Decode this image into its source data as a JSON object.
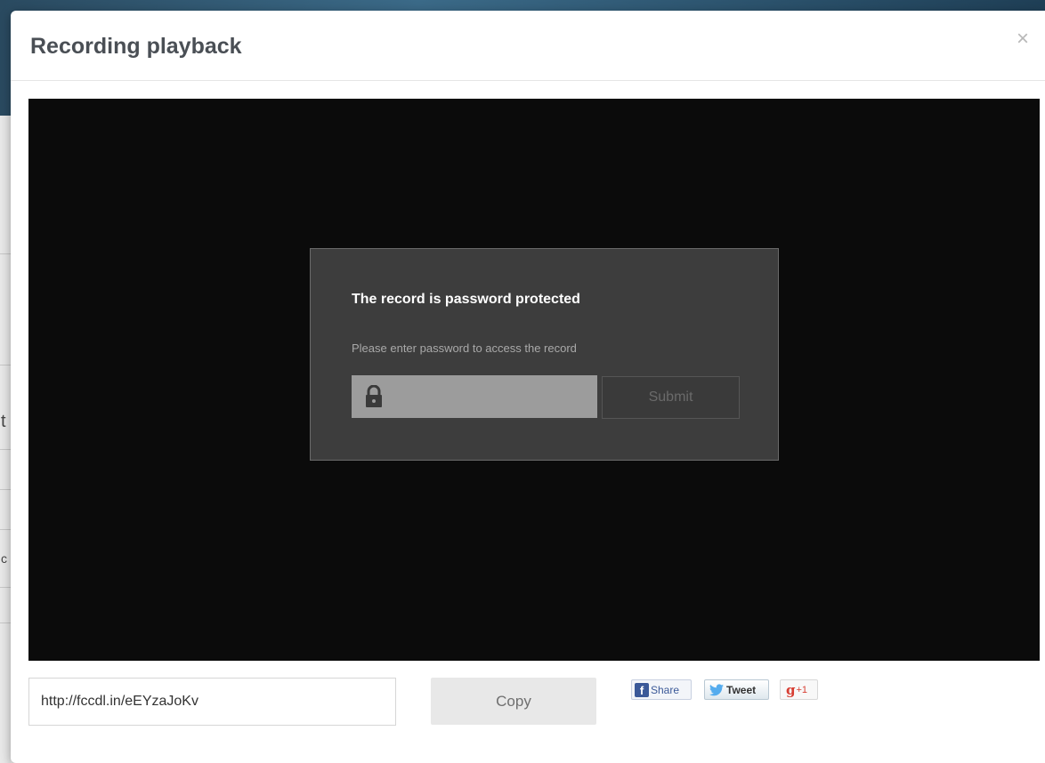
{
  "modal": {
    "title": "Recording playback",
    "close_icon": "close-icon",
    "close_glyph": "×"
  },
  "password_dialog": {
    "title": "The record is password protected",
    "subtitle": "Please enter password to access the record",
    "password_value": "",
    "lock_icon": "lock-icon",
    "submit_label": "Submit"
  },
  "share_bar": {
    "url_value": "http://fccdl.in/eEYzaJoKv",
    "copy_label": "Copy",
    "facebook_label": "Share",
    "facebook_icon": "facebook-icon",
    "facebook_glyph": "f",
    "twitter_label": "Tweet",
    "twitter_icon": "twitter-icon",
    "gplus_g": "g",
    "gplus_plus": "+1",
    "gplus_icon": "google-plus-icon"
  },
  "background": {
    "glyph_1": "t",
    "glyph_2": "c"
  },
  "colors": {
    "player_bg": "#0b0b0b",
    "dialog_bg": "#3d3d3d",
    "title_text": "#4a4f55",
    "facebook": "#3b5998",
    "twitter": "#55acee",
    "gplus": "#d73d32"
  }
}
